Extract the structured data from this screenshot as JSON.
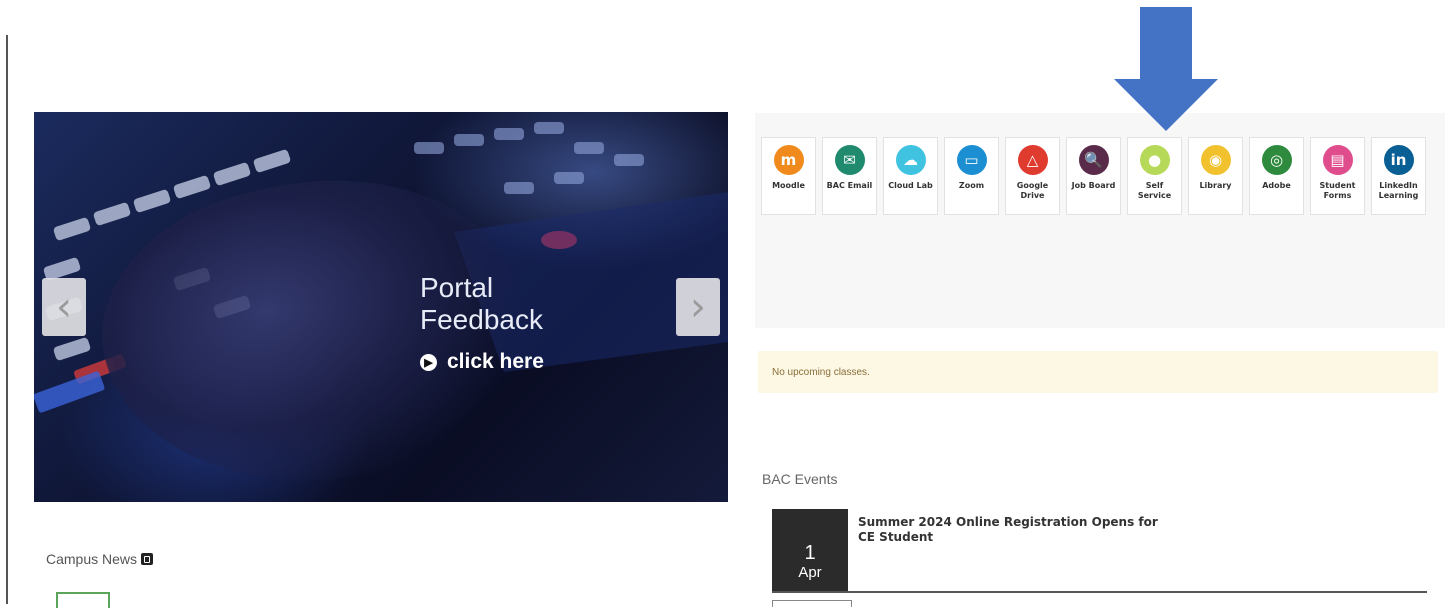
{
  "carousel": {
    "slide_title": "Portal Feedback",
    "slide_link": "click here"
  },
  "campus_news": {
    "heading": "Campus News"
  },
  "apps": [
    {
      "label": "Moodle",
      "icon": "moodle-icon",
      "color": "#f08a1c",
      "glyph": "m"
    },
    {
      "label": "BAC Email",
      "icon": "email-icon",
      "color": "#1f8a6e",
      "glyph": "✉"
    },
    {
      "label": "Cloud Lab",
      "icon": "cloud-icon",
      "color": "#3fc3e0",
      "glyph": "☁"
    },
    {
      "label": "Zoom",
      "icon": "video-camera-icon",
      "color": "#1b8fd2",
      "glyph": "▭"
    },
    {
      "label": "Google Drive",
      "icon": "drive-icon",
      "color": "#e03b2f",
      "glyph": "△"
    },
    {
      "label": "Job Board",
      "icon": "search-icon",
      "color": "#5a2a4a",
      "glyph": "🔍"
    },
    {
      "label": "Self Service",
      "icon": "user-icon",
      "color": "#b6d95a",
      "glyph": "●"
    },
    {
      "label": "Library",
      "icon": "book-icon",
      "color": "#f2c12e",
      "glyph": "◉"
    },
    {
      "label": "Adobe",
      "icon": "creative-cloud-icon",
      "color": "#2e8b3e",
      "glyph": "◎"
    },
    {
      "label": "Student Forms",
      "icon": "document-icon",
      "color": "#e04d8c",
      "glyph": "▤"
    },
    {
      "label": "LinkedIn Learning",
      "icon": "linkedin-icon",
      "color": "#0a5f94",
      "glyph": "in"
    }
  ],
  "classes": {
    "notice": "No upcoming classes."
  },
  "events": {
    "heading": "BAC Events",
    "items": [
      {
        "day": "1",
        "month": "Apr",
        "title": "Summer 2024 Online Registration Opens for CE Student"
      }
    ]
  },
  "annotation": {
    "arrow_color": "#4472c4",
    "points_to": "Self Service"
  }
}
